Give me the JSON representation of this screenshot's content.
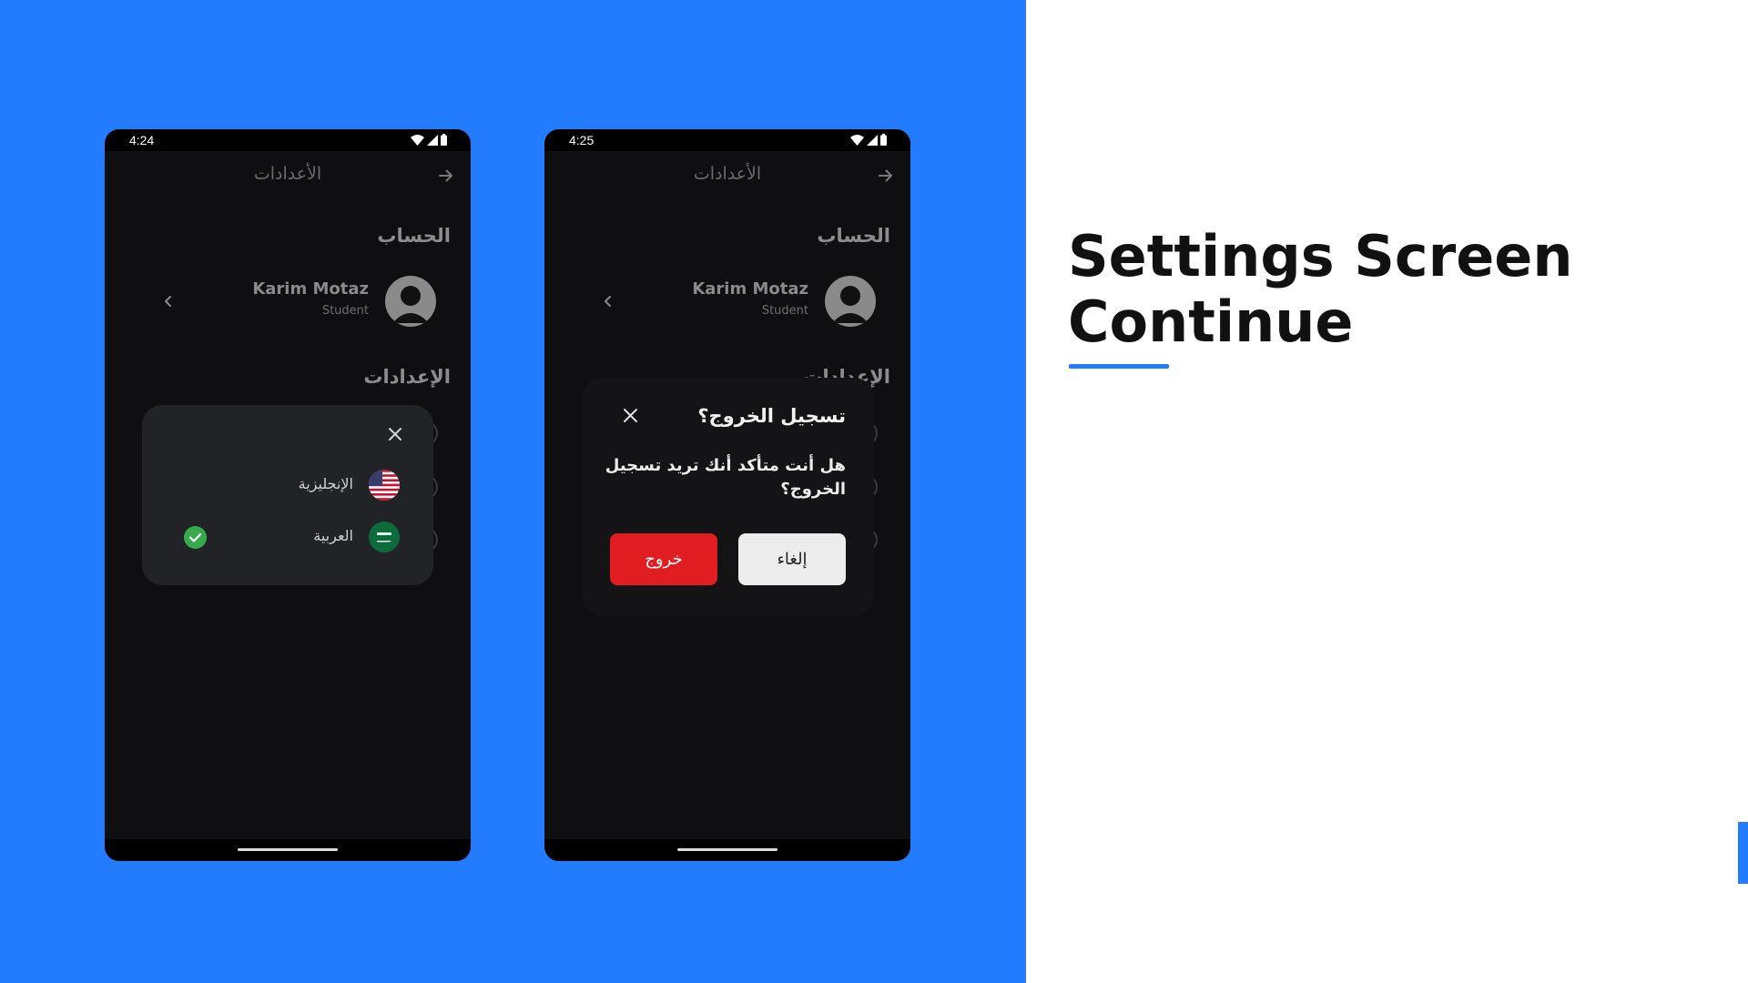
{
  "slide": {
    "title_line1": "Settings Screen",
    "title_line2": "Continue"
  },
  "colors": {
    "brand_blue": "#237bfe",
    "danger_red": "#e21d22",
    "check_green": "#35a94b"
  },
  "screens": [
    {
      "status_time": "4:24",
      "appbar_title": "الأعدادات",
      "account_section": "الحساب",
      "user_name": "Karim Motaz",
      "user_role": "Student",
      "settings_section": "الإعدادات",
      "language_sheet": {
        "options": [
          {
            "label": "الإنجليزية",
            "flag": "us-flag",
            "selected": false
          },
          {
            "label": "العربية",
            "flag": "saudi-flag",
            "selected": true
          }
        ]
      }
    },
    {
      "status_time": "4:25",
      "appbar_title": "الأعدادات",
      "account_section": "الحساب",
      "user_name": "Karim Motaz",
      "user_role": "Student",
      "settings_section": "الإعدادات",
      "logout_dialog": {
        "title": "تسجيل الخروج؟",
        "message": "هل أنت متأكد أنك تريد تسجيل الخروج؟",
        "cancel_label": "إلغاء",
        "confirm_label": "خروج"
      }
    }
  ],
  "icons": [
    "wifi-icon",
    "signal-icon",
    "battery-icon",
    "back-arrow-icon",
    "chevron-left-icon",
    "avatar-icon",
    "close-icon",
    "check-icon",
    "us-flag-icon",
    "saudi-flag-icon"
  ]
}
